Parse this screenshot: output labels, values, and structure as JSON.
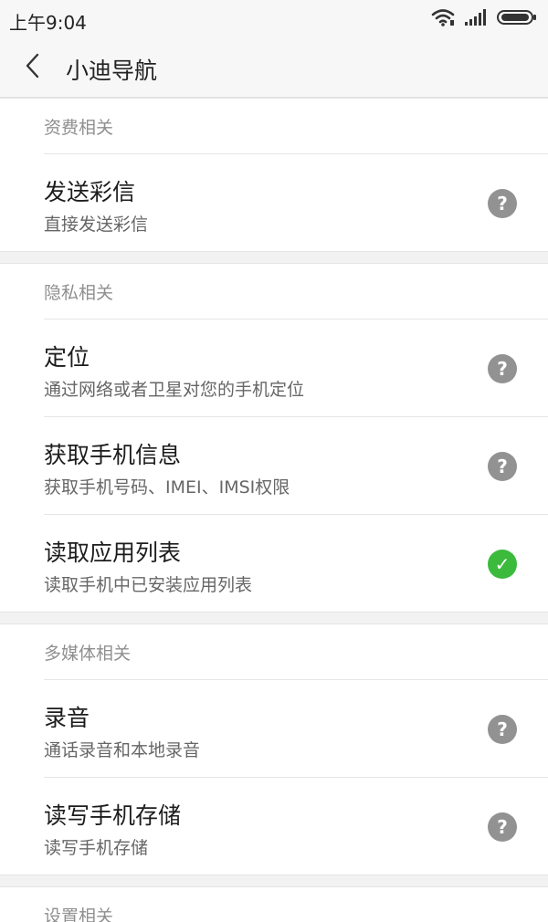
{
  "status_bar": {
    "time": "上午9:04",
    "icons": [
      "wifi-icon",
      "signal-icon",
      "battery-icon"
    ]
  },
  "app_bar": {
    "title": "小迪导航",
    "back_icon": "chevron-left-icon"
  },
  "groups": [
    {
      "header": "资费相关",
      "items": [
        {
          "title": "发送彩信",
          "subtitle": "直接发送彩信",
          "icon": "help-icon",
          "color": "#929292"
        }
      ]
    },
    {
      "header": "隐私相关",
      "items": [
        {
          "title": "定位",
          "subtitle": "通过网络或者卫星对您的手机定位",
          "icon": "help-icon",
          "color": "#929292"
        },
        {
          "title": "获取手机信息",
          "subtitle": "获取手机号码、IMEI、IMSI权限",
          "icon": "help-icon",
          "color": "#929292"
        },
        {
          "title": "读取应用列表",
          "subtitle": "读取手机中已安装应用列表",
          "icon": "check-icon",
          "color": "#3cba3c"
        }
      ]
    },
    {
      "header": "多媒体相关",
      "items": [
        {
          "title": "录音",
          "subtitle": "通话录音和本地录音",
          "icon": "help-icon",
          "color": "#929292"
        },
        {
          "title": "读写手机存储",
          "subtitle": "读写手机存储",
          "icon": "help-icon",
          "color": "#929292"
        }
      ]
    },
    {
      "header": "设置相关",
      "items": []
    }
  ],
  "colors": {
    "accent_check": "#3cba3c",
    "help_gray": "#929292"
  },
  "glyphs": {
    "help": "?",
    "check": "✓"
  }
}
